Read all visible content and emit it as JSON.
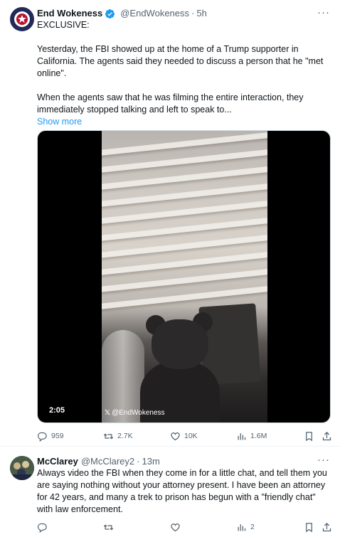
{
  "tweet1": {
    "display_name": "End Wokeness",
    "handle": "@EndWokeness",
    "separator": "·",
    "time": "5h",
    "more_label": "···",
    "paragraphs": [
      "EXCLUSIVE:",
      "Yesterday, the FBI showed up at the home of a Trump supporter in California. The agents said they needed to discuss a person that he \"met online\".",
      "When the agents saw that he was filming the entire interaction, they immediately stopped talking and left to speak to..."
    ],
    "show_more": "Show more",
    "video": {
      "duration": "2:05",
      "watermark": "@EndWokeness",
      "watermark_logo": "𝕏"
    },
    "stats": {
      "replies": "959",
      "retweets": "2.7K",
      "likes": "10K",
      "views": "1.6M"
    }
  },
  "tweet2": {
    "display_name": "McClarey",
    "handle": "@McClarey2",
    "separator": "·",
    "time": "13m",
    "more_label": "···",
    "text": "Always video the FBI when they come in for a little chat, and tell them you are saying nothing without your attorney present.  I have been an attorney for 42 years, and many a trek to prison has begun with a \"friendly chat\" with law enforcement.",
    "stats": {
      "replies": "",
      "retweets": "",
      "likes": "",
      "views": "2"
    }
  },
  "icons": {
    "verified": "verified-badge-icon",
    "reply": "reply-icon",
    "retweet": "retweet-icon",
    "like": "heart-icon",
    "views": "views-chart-icon",
    "bookmark": "bookmark-icon",
    "share": "share-icon"
  },
  "colors": {
    "text_primary": "#0f1419",
    "text_secondary": "#536471",
    "link": "#1d9bf0",
    "verified": "#1d9bf0",
    "divider": "#eff3f4"
  }
}
